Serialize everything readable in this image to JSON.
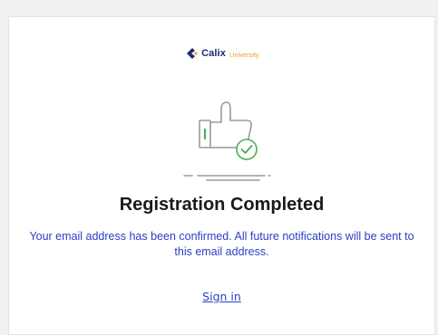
{
  "brand": {
    "name": "Calix",
    "sub": "University",
    "logo_icon": "calix-logo-icon",
    "primary_color": "#1c2a6e",
    "accent_color": "#f39a2b"
  },
  "illustration": {
    "icon": "thumbs-up-check-icon",
    "check_color": "#4caf50",
    "line_color": "#9a9a9a"
  },
  "heading": "Registration Completed",
  "message": "Your email address has been confirmed. All future notifications will be sent to this email address.",
  "link": {
    "label": "Sign in",
    "color": "#2b3fc4"
  }
}
